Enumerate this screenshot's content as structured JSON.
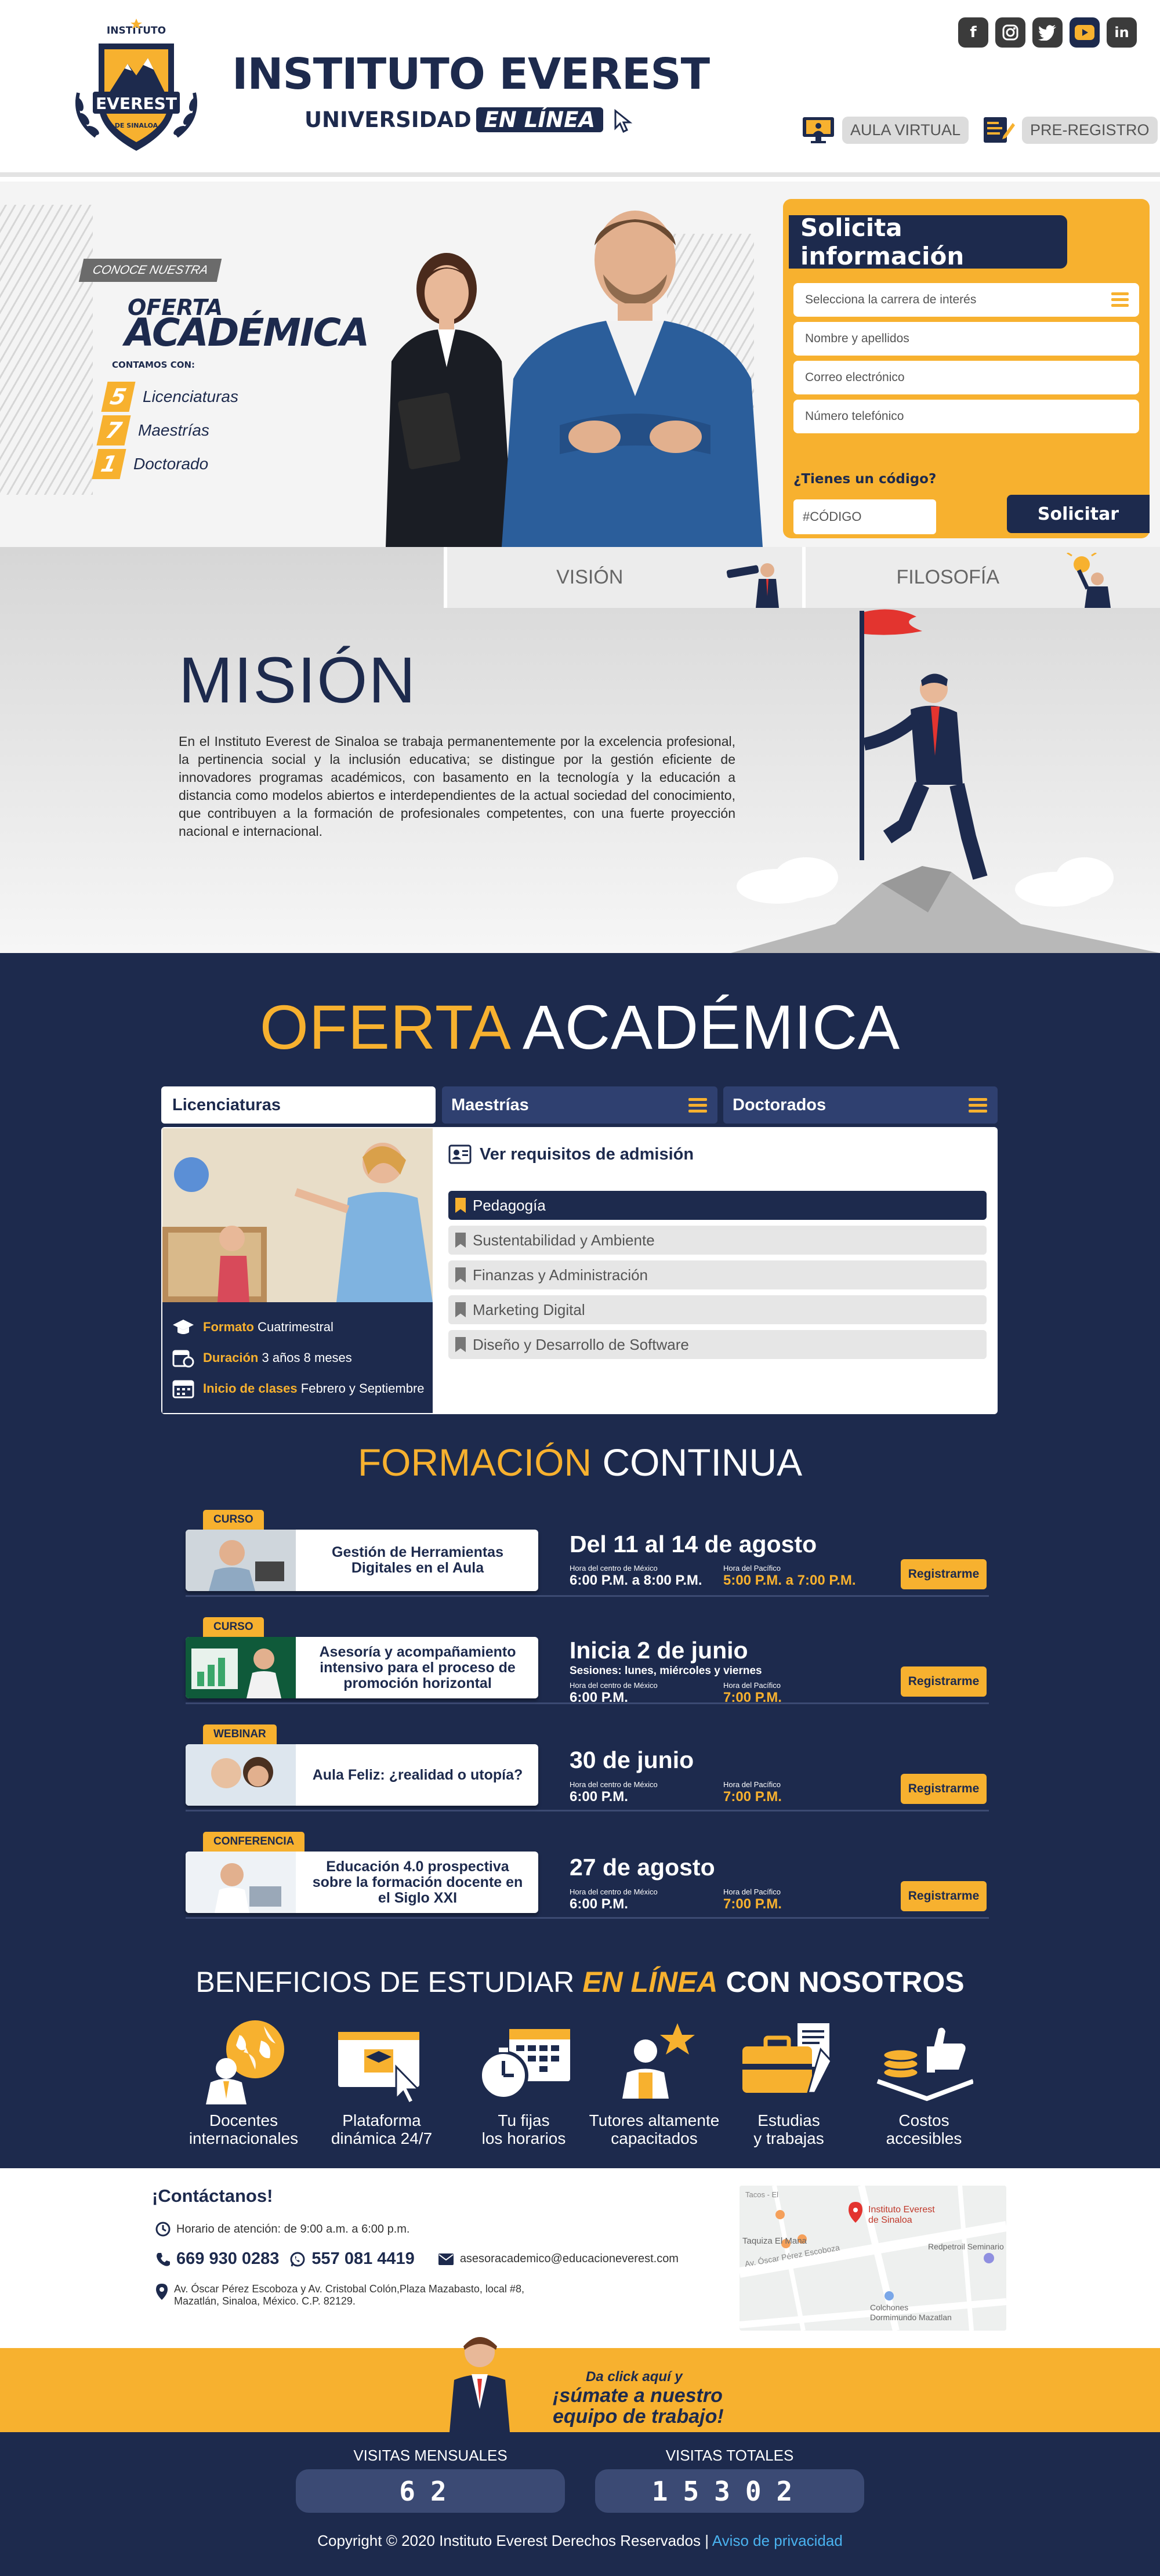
{
  "header": {
    "logo_top": "INSTITUTO",
    "logo_main": "EVEREST",
    "logo_bottom": "DE SINALOA",
    "title": "INSTITUTO EVEREST",
    "subtitle": "UNIVERSIDAD",
    "subtitle_pill": "EN LÍNEA",
    "social": [
      {
        "icon": "facebook-icon",
        "glyph": "f"
      },
      {
        "icon": "instagram-icon",
        "glyph": "◎"
      },
      {
        "icon": "twitter-icon",
        "glyph": "🐦"
      },
      {
        "icon": "youtube-icon",
        "glyph": "▶"
      },
      {
        "icon": "linkedin-icon",
        "glyph": "in"
      }
    ],
    "aula_virtual": "AULA VIRTUAL",
    "pre_registro": "PRE-REGISTRO"
  },
  "hero": {
    "conoce": "CONOCE NUESTRA",
    "oferta": "OFERTA",
    "academica": "ACADÉMICA",
    "contamos": "CONTAMOS CON:",
    "counts": [
      {
        "num": "5",
        "label": "Licenciaturas"
      },
      {
        "num": "7",
        "label": "Maestrías"
      },
      {
        "num": "1",
        "label": "Doctorado"
      }
    ]
  },
  "form": {
    "title": "Solicita información",
    "career_placeholder": "Selecciona la carrera de interés",
    "name_placeholder": "Nombre y apellidos",
    "email_placeholder": "Correo electrónico",
    "phone_placeholder": "Número telefónico",
    "code_question": "¿Tienes un código?",
    "code_placeholder": "#CÓDIGO",
    "submit": "Solicitar"
  },
  "mision": {
    "tabs": [
      "VISIÓN",
      "FILOSOFÍA"
    ],
    "title": "MISIÓN",
    "text": "En el Instituto Everest de Sinaloa se trabaja permanentemente por la excelencia profesional, la pertinencia social y la inclusión educativa; se distingue por la gestión eficiente de innovadores programas académicos, con basamento en la tecnología y la educación a distancia como modelos abiertos e interdependientes de la actual sociedad del conocimiento, que contribuyen a la formación de profesionales competentes, con una fuerte proyección nacional e internacional."
  },
  "oferta": {
    "title_a": "OFERTA",
    "title_b": "ACADÉMICA",
    "tabs": [
      "Licenciaturas",
      "Maestrías",
      "Doctorados"
    ],
    "formato_label": "Formato",
    "formato": "Cuatrimestral",
    "duracion_label": "Duración",
    "duracion": "3 años 8 meses",
    "inicio_label": "Inicio de clases",
    "inicio": "Febrero y Septiembre",
    "requisitos": "Ver requisitos de admisión",
    "programs": [
      "Pedagogía",
      "Sustentabilidad y Ambiente",
      "Finanzas y Administración",
      "Marketing Digital",
      "Diseño y Desarrollo de Software"
    ]
  },
  "formacion": {
    "title_a": "FORMACIÓN",
    "title_b": "CONTINUA",
    "mx_label": "Hora del centro de México",
    "pac_label": "Hora del Pacífico",
    "register": "Registrarme",
    "courses": [
      {
        "badge": "CURSO",
        "name": "Gestión de Herramientas Digitales en el Aula",
        "date": "Del 11 al 14 de agosto",
        "sessions": "",
        "mx": "6:00 P.M. a 8:00 P.M.",
        "pac": "5:00 P.M. a 7:00 P.M."
      },
      {
        "badge": "CURSO",
        "name": "Asesoría y acompañamiento intensivo para el proceso de promoción horizontal",
        "date": "Inicia 2 de junio",
        "sessions": "Sesiones: lunes, miércoles y viernes",
        "mx": "6:00 P.M.",
        "pac": "7:00 P.M."
      },
      {
        "badge": "WEBINAR",
        "name": "Aula Feliz: ¿realidad o utopía?",
        "date": "30 de junio",
        "sessions": "",
        "mx": "6:00 P.M.",
        "pac": "7:00 P.M."
      },
      {
        "badge": "CONFERENCIA",
        "name": "Educación 4.0 prospectiva sobre la formación docente en el Siglo XXI",
        "date": "27 de agosto",
        "sessions": "",
        "mx": "6:00 P.M.",
        "pac": "7:00 P.M."
      }
    ]
  },
  "beneficios": {
    "title_a": "BENEFICIOS DE ESTUDIAR",
    "title_em": "EN LÍNEA",
    "title_b": "CON NOSOTROS",
    "items": [
      {
        "l1": "Docentes",
        "l2": "internacionales"
      },
      {
        "l1": "Plataforma",
        "l2": "dinámica 24/7"
      },
      {
        "l1": "Tu fijas",
        "l2": "los horarios"
      },
      {
        "l1": "Tutores altamente",
        "l2": "capacitados"
      },
      {
        "l1": "Estudias",
        "l2": "y trabajas"
      },
      {
        "l1": "Costos",
        "l2": "accesibles"
      }
    ]
  },
  "contact": {
    "title": "¡Contáctanos!",
    "hours": "Horario de atención: de 9:00 a.m. a 6:00 p.m.",
    "phone": "669 930 0283",
    "whatsapp": "557 081 4419",
    "email": "asesoracademico@educacioneverest.com",
    "address1": "Av. Óscar Pérez Escoboza y Av. Cristobal Colón,Plaza Mazabasto, local #8,",
    "address2": "Mazatlán, Sinaloa, México. C.P. 82129.",
    "map_labels": [
      "Instituto Everest",
      "de Sinaloa",
      "Redpetroil Seminario",
      "Taquiza El Mana",
      "Av. Óscar Pérez Escoboza",
      "Colchones",
      "Dormimundo Mazatlan",
      "Tacos - El"
    ]
  },
  "join": {
    "line1": "Da click aquí y",
    "line2": "¡súmate a nuestro",
    "line3": "equipo de trabajo!"
  },
  "footer": {
    "monthly_label": "VISITAS MENSUALES",
    "monthly": "62",
    "total_label": "VISITAS TOTALES",
    "total": "15302",
    "copyright": "Copyright © 2020 Instituto Everest Derechos Reservados |",
    "privacy": "Aviso de privacidad"
  },
  "colors": {
    "navy": "#1d2a4d",
    "gold": "#f7b12f",
    "link": "#4ab3f0"
  }
}
